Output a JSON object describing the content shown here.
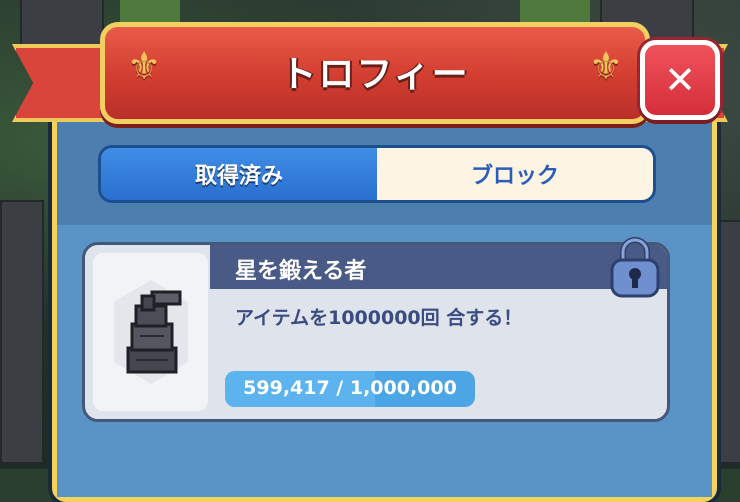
{
  "header": {
    "title": "トロフィー"
  },
  "close": {
    "label": "✕"
  },
  "tabs": [
    {
      "label": "取得済み",
      "active": true
    },
    {
      "label": "ブロック",
      "active": false
    }
  ],
  "trophy": {
    "name": "星を鍛える者",
    "description": "アイテムを1000000回 合する！",
    "progress_text": "599,417 / 1,000,000",
    "progress_fraction": 0.599417,
    "locked": true
  },
  "colors": {
    "ribbon": "#d9453a",
    "panel_border": "#f3d35a",
    "tab_active": "#2a6fcf",
    "progress": "#4ca6e6"
  },
  "icons": [
    "fleur-de-lis-icon",
    "close-icon",
    "padlock-icon",
    "stone-tower-icon"
  ]
}
